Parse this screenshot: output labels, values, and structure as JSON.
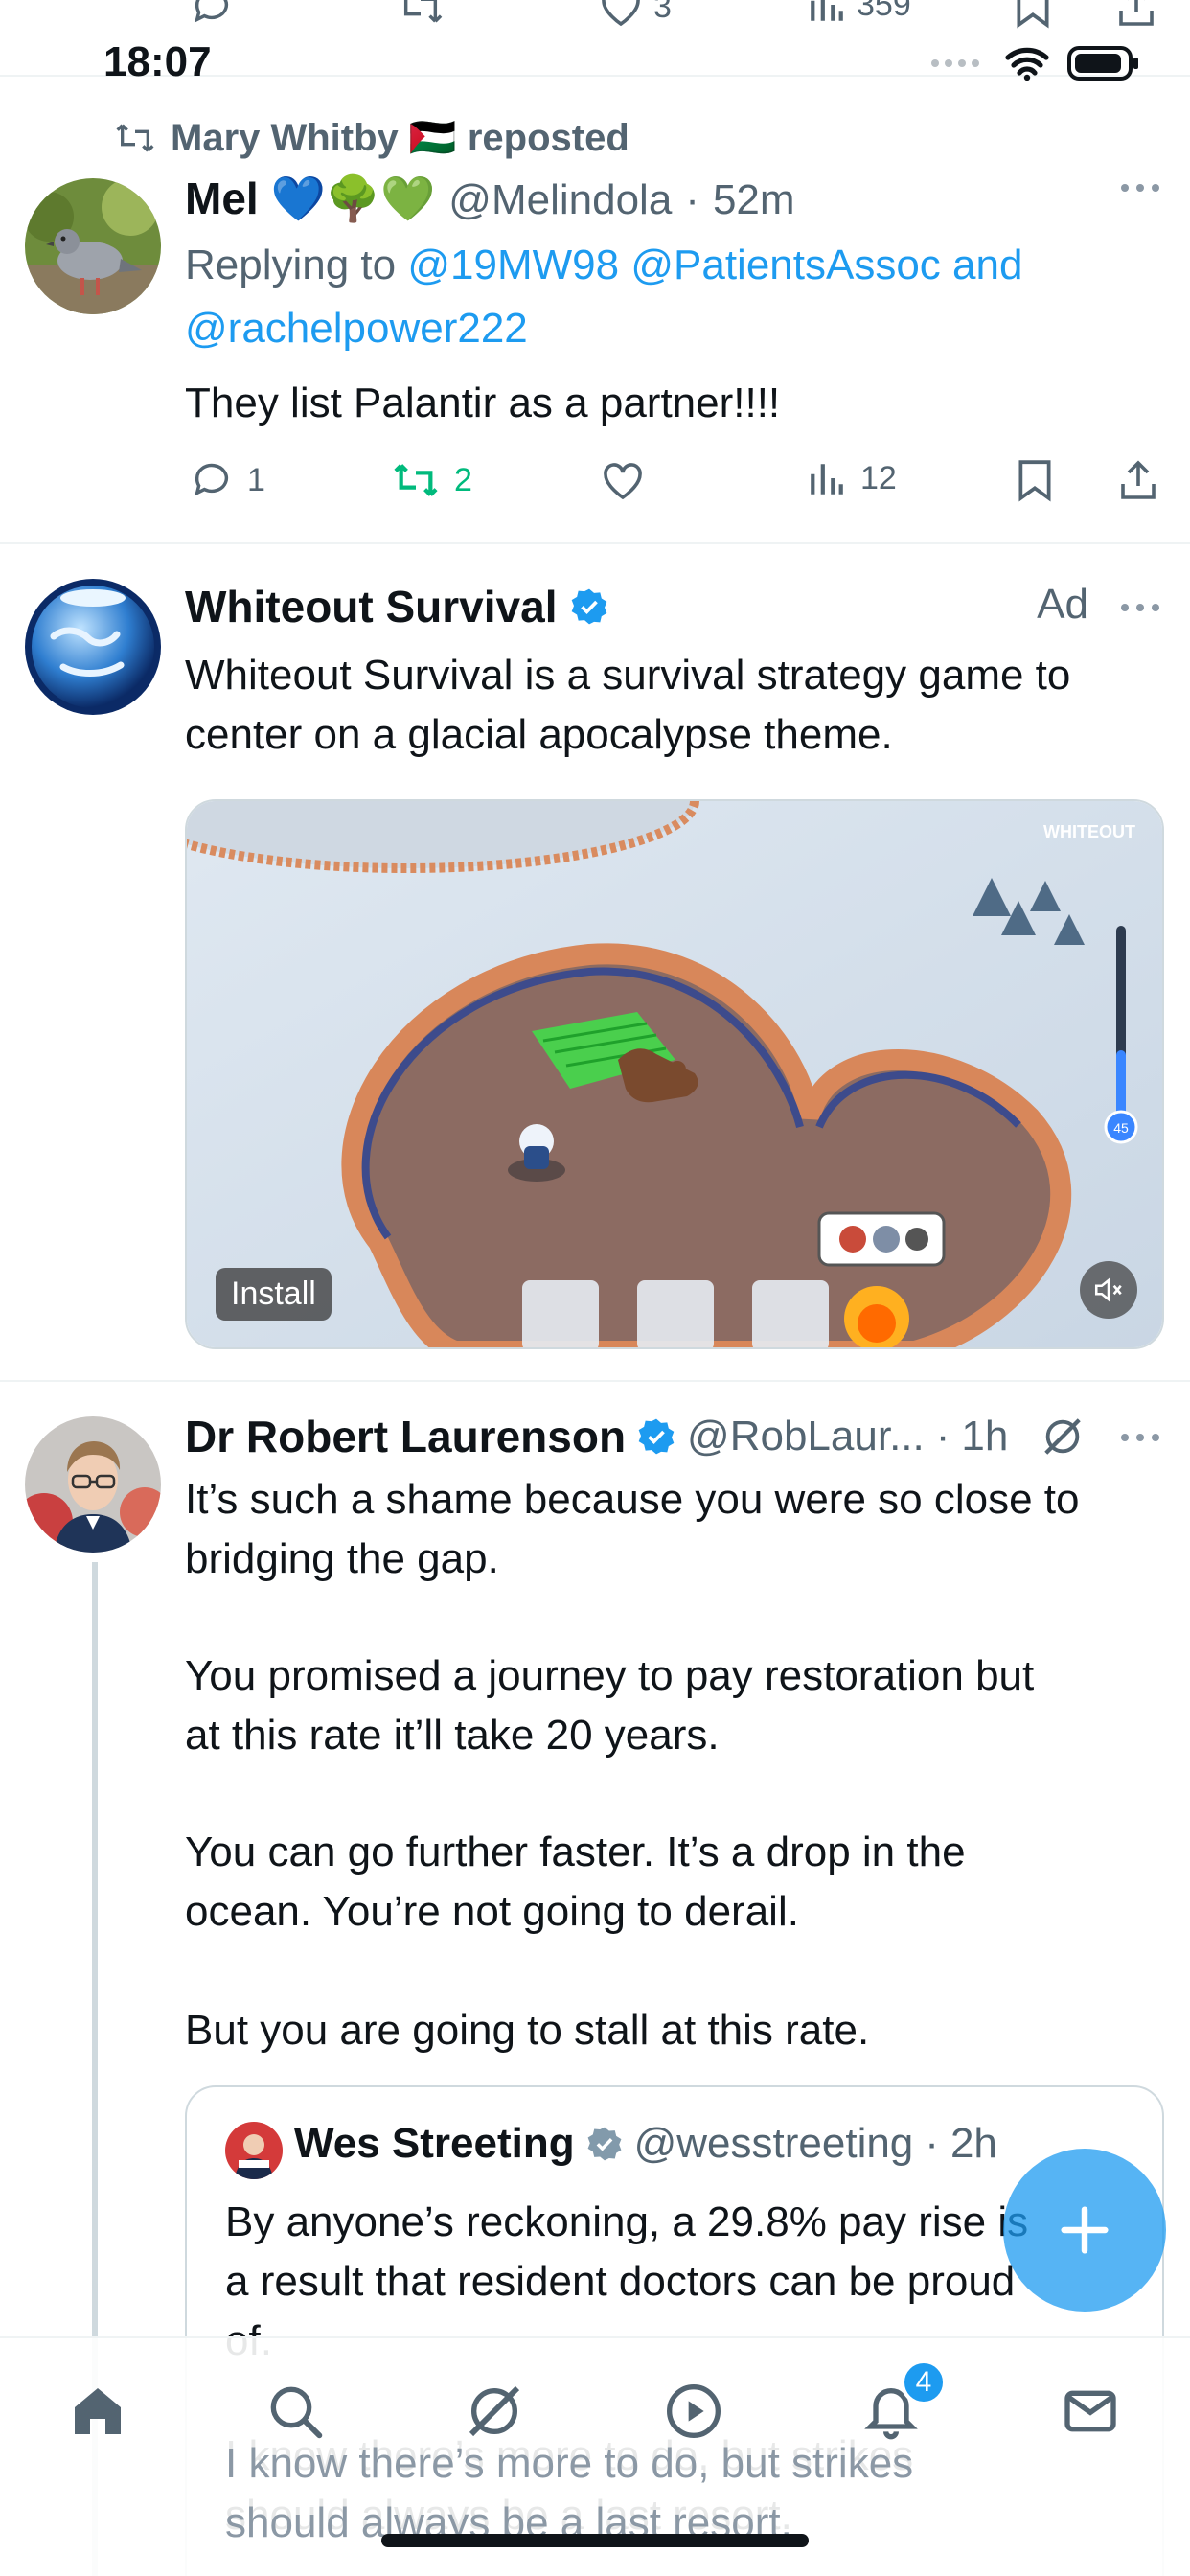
{
  "status_bar": {
    "time": "18:07"
  },
  "previous_tweet_actions": {
    "likes": "3",
    "views": "359"
  },
  "tweet1": {
    "repost_label": "Mary Whitby 🇵🇸 reposted",
    "author_name": "Mel 💙🌳💚",
    "author_handle": "@Melindola",
    "time": "52m",
    "replying_prefix": "Replying to",
    "replying_to_1": "@19MW98 @PatientsAssoc and",
    "replying_to_2": "@rachelpower222",
    "text": "They list Palantir as a partner!!!!",
    "replies": "1",
    "reposts": "2",
    "views": "12"
  },
  "ad": {
    "author_name": "Whiteout Survival",
    "ad_label": "Ad",
    "text_line1": "Whiteout Survival is a survival strategy game to",
    "text_line2": "center on a glacial apocalypse theme.",
    "install_label": "Install",
    "media_watermark": "WHITEOUT",
    "level_value": "45"
  },
  "tweet2": {
    "author_name": "Dr Robert Laurenson",
    "author_handle": "@RobLaur...",
    "time": "1h",
    "para1_line1": "It’s such a shame because you were so close to",
    "para1_line2": "bridging the gap.",
    "para2_line1": "You promised a journey to pay restoration but",
    "para2_line2": "at this rate it’ll take 20 years.",
    "para3_line1": "You can go further faster. It’s a drop in the",
    "para3_line2": "ocean. You’re not going to derail.",
    "para4": "But you are going to stall at this rate.",
    "quote": {
      "author_name": "Wes Streeting",
      "author_handle": "@wesstreeting",
      "time": "2h",
      "line1": "By anyone’s reckoning, a 29.8% pay rise is",
      "line2": "a result that resident doctors can be proud",
      "line3": "of.",
      "line4": "I know there’s more to do, but strikes",
      "line5": "should always be a last resort."
    }
  },
  "tabbar": {
    "notifications_badge": "4"
  },
  "colors": {
    "accent": "#1d9bf0",
    "repost_green": "#00ba7c",
    "text": "#0f1419",
    "muted": "#536471"
  }
}
